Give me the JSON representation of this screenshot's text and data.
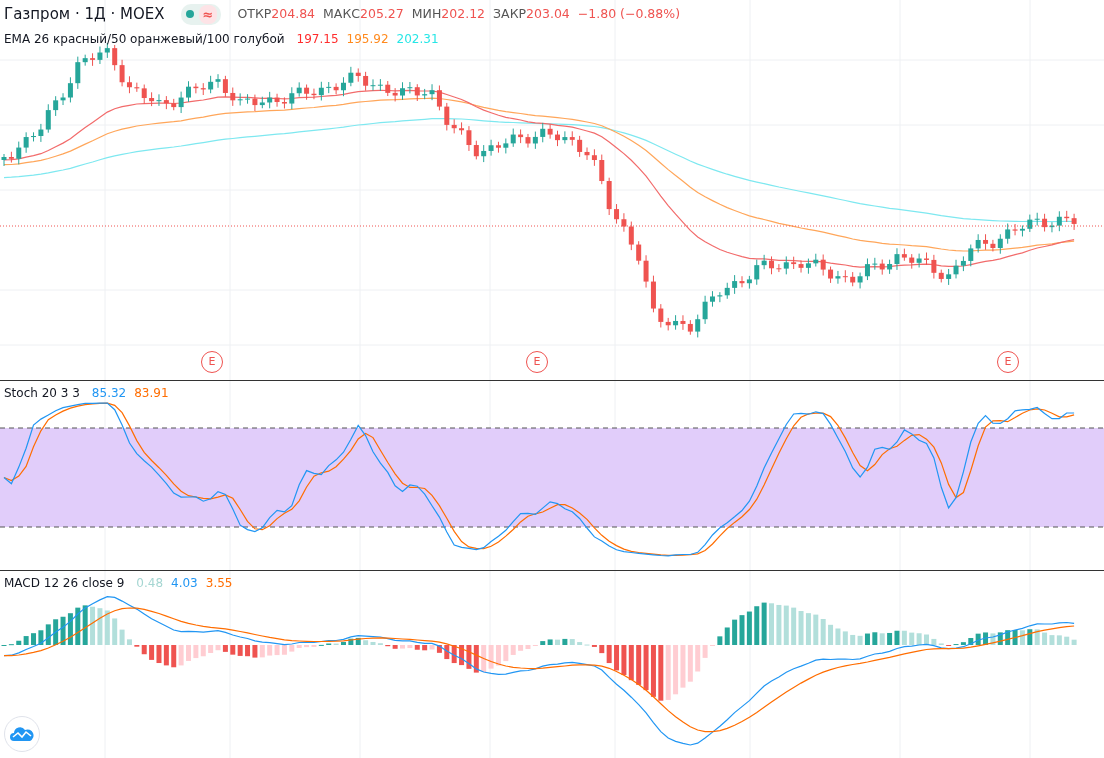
{
  "main_pane": {
    "title": "Газпром · 1Д · MOEX",
    "status_badge": {
      "symbol": "≈"
    },
    "quotes": [
      {
        "label": "ОТКР",
        "value": "204.84"
      },
      {
        "label": "МАКС",
        "value": "205.27"
      },
      {
        "label": "МИН",
        "value": "202.12"
      },
      {
        "label": "ЗАКР",
        "value": "203.04"
      }
    ],
    "change": "−1.80 (−0.88%)",
    "ema_legend": {
      "label": "EMA 26 красный/50 оранжевый/100 голубой",
      "values": [
        {
          "text": "197.15",
          "color": "#ff2d2d"
        },
        {
          "text": "195.92",
          "color": "#ff8a1e"
        },
        {
          "text": "202.31",
          "color": "#27e6e6"
        }
      ]
    },
    "earnings_markers": [
      "E",
      "E",
      "E"
    ]
  },
  "stoch_pane": {
    "label": "Stoch 20 3 3",
    "values": [
      {
        "text": "85.32",
        "color": "#2196f3"
      },
      {
        "text": "83.91",
        "color": "#ff6d00"
      }
    ]
  },
  "macd_pane": {
    "label": "MACD 12 26 close 9",
    "values": [
      {
        "text": "0.48",
        "color": "#a5d6d2"
      },
      {
        "text": "4.03",
        "color": "#2196f3"
      },
      {
        "text": "3.55",
        "color": "#ff6d00"
      }
    ]
  }
}
